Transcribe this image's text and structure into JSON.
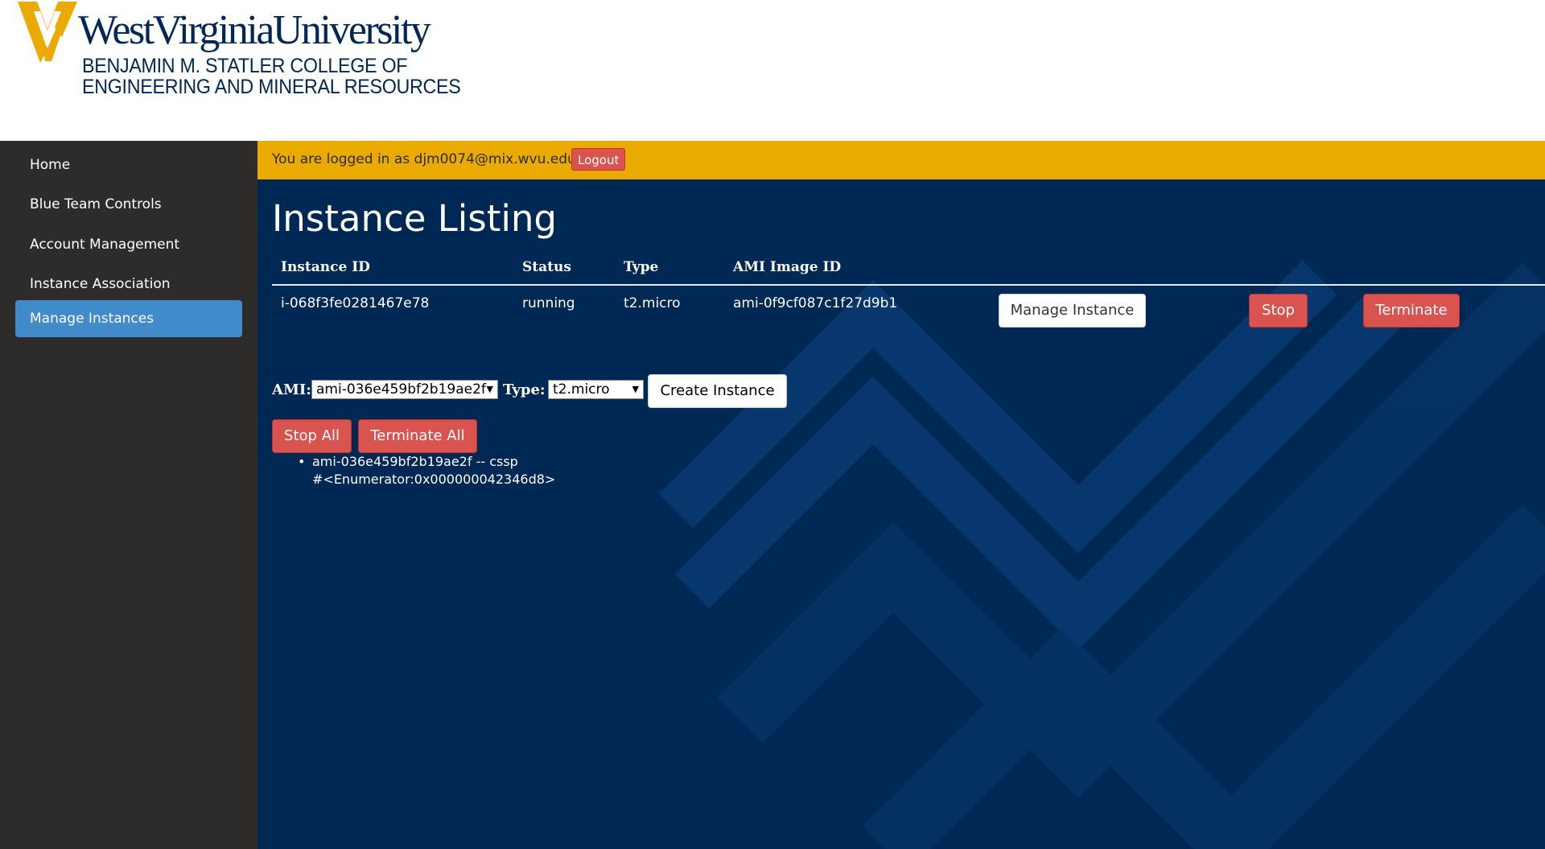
{
  "header": {
    "university": "WestVirginiaUniversity",
    "college_line1": "BENJAMIN M. STATLER COLLEGE OF",
    "college_line2": "ENGINEERING AND MINERAL RESOURCES"
  },
  "sidebar": {
    "items": [
      {
        "label": "Home"
      },
      {
        "label": "Blue Team Controls"
      },
      {
        "label": "Account Management"
      },
      {
        "label": "Instance Association"
      },
      {
        "label": "Manage Instances",
        "active": true
      }
    ]
  },
  "login_bar": {
    "text": "You are logged in as djm0074@mix.wvu.edu",
    "logout_label": "Logout"
  },
  "main": {
    "title": "Instance Listing",
    "table": {
      "headers": [
        "Instance ID",
        "Status",
        "Type",
        "AMI Image ID"
      ],
      "rows": [
        {
          "instance_id": "i-068f3fe0281467e78",
          "status": "running",
          "type": "t2.micro",
          "ami": "ami-0f9cf087c1f27d9b1",
          "manage_label": "Manage Instance",
          "stop_label": "Stop",
          "terminate_label": "Terminate"
        }
      ]
    },
    "create_form": {
      "ami_label": "AMI:",
      "ami_value": "ami-036e459bf2b19ae2f",
      "type_label": "Type:",
      "type_value": "t2.micro",
      "create_label": "Create Instance"
    },
    "stop_all_label": "Stop All",
    "terminate_all_label": "Terminate All",
    "ami_list": [
      {
        "line1": "ami-036e459bf2b19ae2f -- cssp",
        "line2": "#<Enumerator:0x000000042346d8>"
      }
    ]
  },
  "colors": {
    "brand_navy": "#002855",
    "brand_gold": "#eaaa00",
    "sidebar_bg": "#2d2c2b",
    "active_item": "#428bca",
    "danger": "#d9534f"
  }
}
